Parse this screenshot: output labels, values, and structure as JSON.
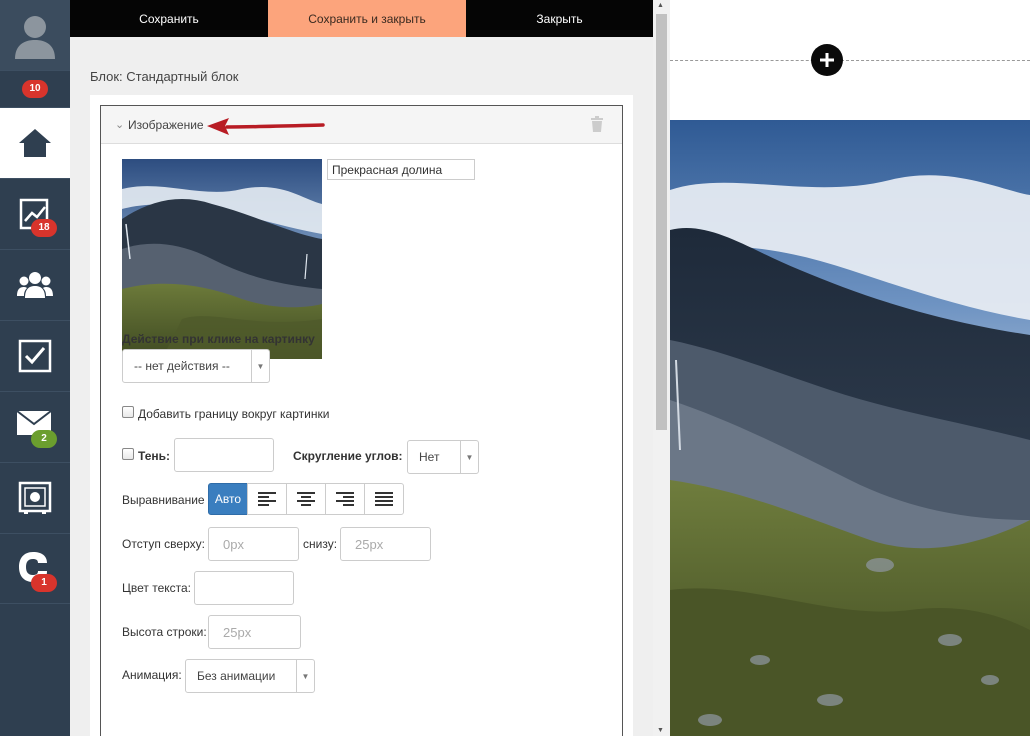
{
  "sidebar": {
    "avatar_badge": "10",
    "items": [
      {
        "name": "home",
        "badge": ""
      },
      {
        "name": "analytics",
        "badge": "18"
      },
      {
        "name": "users",
        "badge": ""
      },
      {
        "name": "tasks",
        "badge": ""
      },
      {
        "name": "mail",
        "badge": "2"
      },
      {
        "name": "safe",
        "badge": ""
      },
      {
        "name": "support",
        "badge": "1"
      }
    ]
  },
  "toolbar": {
    "save_label": "Сохранить",
    "save_close_label": "Сохранить и закрыть",
    "close_label": "Закрыть"
  },
  "editor": {
    "block_title": "Блок: Стандартный блок",
    "panel_title": "Изображение",
    "image_caption": "Прекрасная долина",
    "click_action_label": "Действие при клике на картинку",
    "click_action_value": "-- нет действия --",
    "border_label": "Добавить границу вокруг картинки",
    "shadow_label": "Тень:",
    "corners_label": "Скругление углов:",
    "corners_value": "Нет",
    "align_label": "Выравнивание",
    "align_auto": "Авто",
    "margin_top_label": "Отступ сверху:",
    "margin_top_placeholder": "0px",
    "margin_bottom_label": "снизу:",
    "margin_bottom_placeholder": "25px",
    "text_color_label": "Цвет текста:",
    "line_height_label": "Высота строки:",
    "line_height_placeholder": "25px",
    "animation_label": "Анимация:",
    "animation_value": "Без анимации"
  }
}
